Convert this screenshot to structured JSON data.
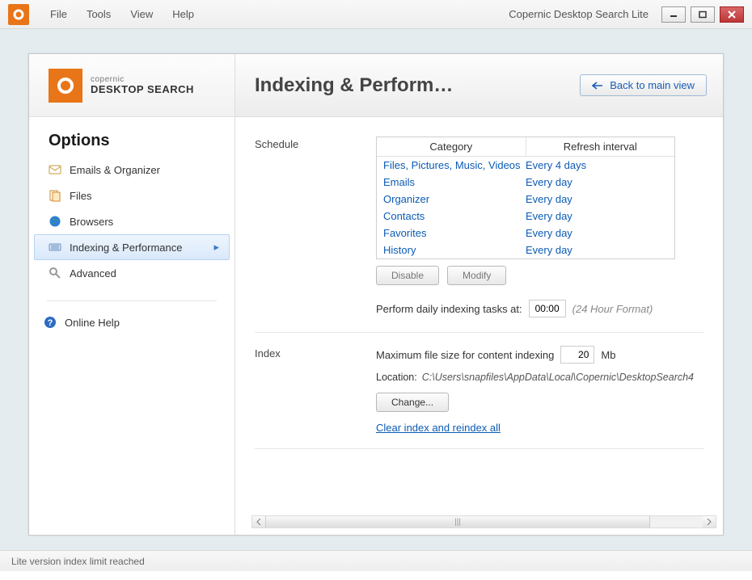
{
  "toolbar": {
    "menus": [
      "File",
      "Tools",
      "View",
      "Help"
    ],
    "app_title": "Copernic Desktop Search Lite"
  },
  "logo": {
    "brand": "copernic",
    "product": "DESKTOP SEARCH"
  },
  "sidebar": {
    "heading": "Options",
    "items": [
      {
        "label": "Emails & Organizer",
        "icon": "mail-icon",
        "selected": false
      },
      {
        "label": "Files",
        "icon": "files-icon",
        "selected": false
      },
      {
        "label": "Browsers",
        "icon": "globe-icon",
        "selected": false
      },
      {
        "label": "Indexing & Performance",
        "icon": "index-icon",
        "selected": true
      },
      {
        "label": "Advanced",
        "icon": "wrench-icon",
        "selected": false
      }
    ],
    "help_label": "Online Help"
  },
  "main": {
    "title": "Indexing & Perform…",
    "back_label": "Back to main view"
  },
  "schedule": {
    "section_label": "Schedule",
    "headers": [
      "Category",
      "Refresh interval"
    ],
    "rows": [
      {
        "category": "Files, Pictures, Music, Videos",
        "interval": "Every 4 days"
      },
      {
        "category": "Emails",
        "interval": "Every day"
      },
      {
        "category": "Organizer",
        "interval": "Every day"
      },
      {
        "category": "Contacts",
        "interval": "Every day"
      },
      {
        "category": "Favorites",
        "interval": "Every day"
      },
      {
        "category": "History",
        "interval": "Every day"
      }
    ],
    "disable_label": "Disable",
    "modify_label": "Modify",
    "daily_label": "Perform daily indexing tasks at:",
    "daily_time": "00:00",
    "daily_hint": "(24 Hour Format)"
  },
  "index": {
    "section_label": "Index",
    "max_label": "Maximum file size for content indexing",
    "max_value": "20",
    "max_unit": "Mb",
    "location_label": "Location:",
    "location_path": "C:\\Users\\snapfiles\\AppData\\Local\\Copernic\\DesktopSearch4",
    "change_label": "Change...",
    "reindex_label": "Clear index and reindex all"
  },
  "status": {
    "text": "Lite version index limit reached"
  }
}
